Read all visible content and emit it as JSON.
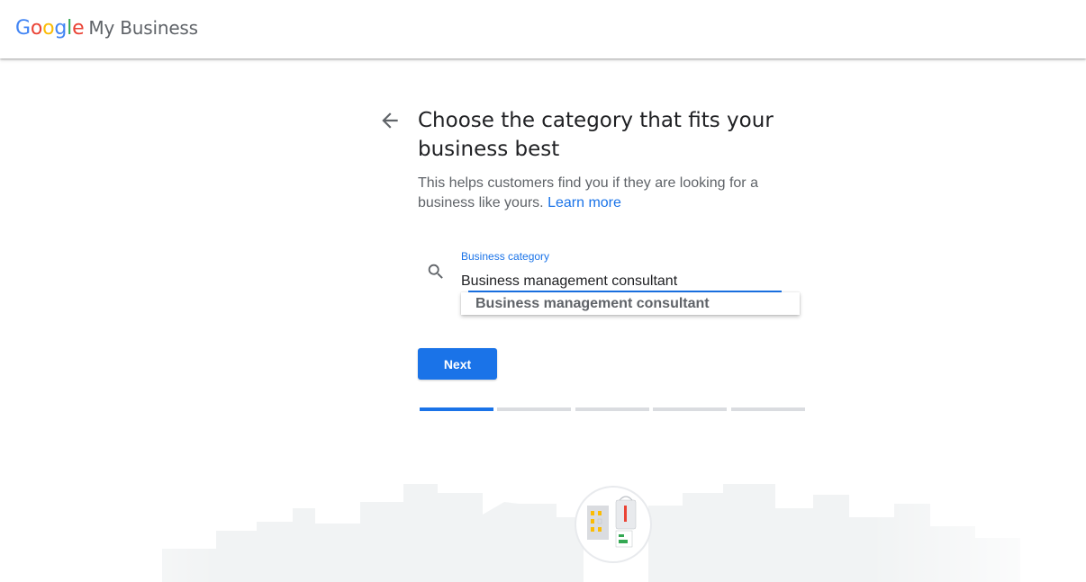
{
  "header": {
    "logo_google": [
      "G",
      "o",
      "o",
      "g",
      "l",
      "e"
    ],
    "logo_colors": [
      "#4285F4",
      "#EA4335",
      "#FBBC05",
      "#4285F4",
      "#34A853",
      "#EA4335"
    ],
    "product_name": "My Business"
  },
  "main": {
    "back_icon": "arrow-back-icon",
    "title": "Choose the category that fits your business best",
    "subtitle": "This helps customers find you if they are looking for a business like yours.",
    "learn_more": "Learn more",
    "field": {
      "icon": "search-icon",
      "label": "Business category",
      "value": "Business management consultant"
    },
    "suggestions": [
      "Business management consultant"
    ],
    "next_label": "Next",
    "progress": {
      "steps": 5,
      "current": 1
    }
  },
  "colors": {
    "accent": "#1a73e8",
    "text_primary": "#202124",
    "text_secondary": "#5f6368",
    "progress_inactive": "#dadce0"
  }
}
